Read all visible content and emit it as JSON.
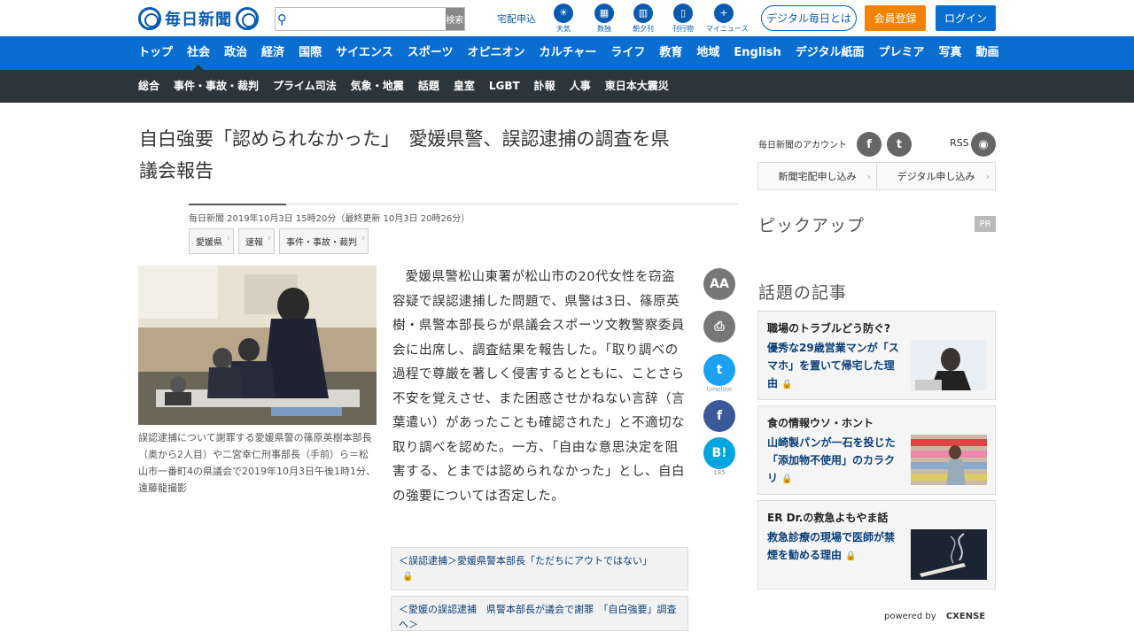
{
  "header": {
    "logo_text": "毎日新聞",
    "search_button": "検索",
    "search_placeholder": "",
    "delivery_link": "宅配申込",
    "icons": [
      {
        "label": "天気",
        "name": "weather-icon"
      },
      {
        "label": "数独",
        "name": "sudoku-icon"
      },
      {
        "label": "朝夕刊",
        "name": "newspaper-icon"
      },
      {
        "label": "刊行物",
        "name": "publication-icon"
      },
      {
        "label": "マイニュース",
        "name": "mynews-icon"
      }
    ],
    "digital_button": "デジタル毎日とは",
    "register_button": "会員登録",
    "login_button": "ログイン",
    "accent_blue": "#0a6ed1",
    "accent_orange": "#f08300"
  },
  "nav_main": [
    "トップ",
    "社会",
    "政治",
    "経済",
    "国際",
    "サイエンス",
    "スポーツ",
    "オピニオン",
    "カルチャー",
    "ライフ",
    "教育",
    "地域",
    "English",
    "デジタル紙面",
    "プレミア",
    "写真",
    "動画"
  ],
  "nav_sub": [
    "総合",
    "事件・事故・裁判",
    "プライム司法",
    "気象・地震",
    "話題",
    "皇室",
    "LGBT",
    "訃報",
    "人事",
    "東日本大震災"
  ],
  "article": {
    "title_line1": "自白強要「認められなかった」　愛媛県警、誤認逮捕の調査を県",
    "title_line2": "議会報告",
    "dateline": "毎日新聞 2019年10月3日 15時20分（最終更新 10月3日 20時26分）",
    "tags": [
      "愛媛県",
      "速報",
      "事件・事故・裁判"
    ],
    "caption": "誤認逮捕について謝罪する愛媛県警の篠原英樹本部長（奥から2人目）や二宮幸仁刑事部長（手前）ら＝松山市一番町4の県議会で2019年10月3日午後1時1分、遠藤龍撮影",
    "body": "愛媛県警松山東署が松山市の20代女性を窃盗容疑で誤認逮捕した問題で、県警は3日、篠原英樹・県警本部長らが県議会スポーツ文教警察委員会に出席し、調査結果を報告した。「取り調べの過程で尊厳を著しく侵害するとともに、ことさら不安を覚えさせ、また困惑させかねない言辞（言葉遣い）があったことも確認された」と不適切な取り調べを認めた。一方、「自由な意思決定を阻害する、とまでは認められなかった」とし、自白の強要については否定した。",
    "related": [
      "＜誤認逮捕＞愛媛県警本部長「ただちにアウトではない」",
      "＜愛媛の誤認逮捕　県警本部長が議会で謝罪　「自白強要」調査へ＞"
    ]
  },
  "share": {
    "font_label": "AA",
    "twitter_label": "timeline",
    "hatena_count": "185"
  },
  "sidebar": {
    "account_label": "毎日新聞のアカウント",
    "rss_label": "RSS",
    "subscribe": [
      "新聞宅配申し込み",
      "デジタル申し込み"
    ],
    "pickup_heading": "ピックアップ",
    "pr_badge": "PR",
    "topics_heading": "話題の記事",
    "cards": [
      {
        "category": "職場のトラブルどう防ぐ?",
        "desc": "優秀な29歳営業マンが「スマホ」を置いて帰宅した理由"
      },
      {
        "category": "食の情報ウソ・ホント",
        "desc": "山崎製パンが一石を投じた「添加物不使用」のカラクリ"
      },
      {
        "category": "ER Dr.の救急よもやま話",
        "desc": "救急診療の現場で医師が禁煙を勧める理由"
      }
    ],
    "powered_by": "powered by",
    "cxense": "CXENSE"
  }
}
